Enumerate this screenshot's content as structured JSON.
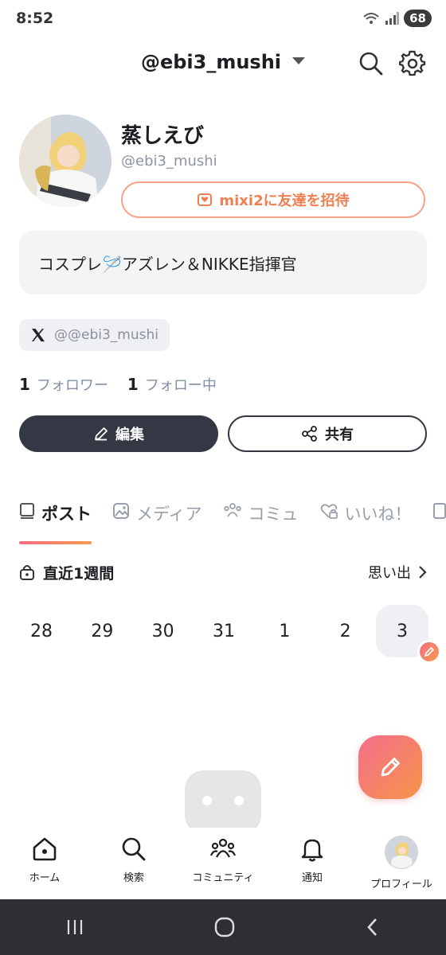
{
  "status_bar": {
    "time": "8:52",
    "battery": "68"
  },
  "header": {
    "username": "@ebi3_mushi"
  },
  "profile": {
    "display_name": "蒸しえび",
    "handle": "@ebi3_mushi",
    "invite_label": "mixi2に友達を招待",
    "bio": "コスプレ🪡アズレン＆NIKKE指揮官",
    "x_link": "@@ebi3_mushi",
    "followers_count": "1",
    "followers_label": "フォロワー",
    "following_count": "1",
    "following_label": "フォロー中",
    "edit_label": "編集",
    "share_label": "共有"
  },
  "tabs": [
    {
      "label": "ポスト",
      "icon": "post-icon",
      "active": true
    },
    {
      "label": "メディア",
      "icon": "image-icon"
    },
    {
      "label": "コミュ",
      "icon": "community-icon"
    },
    {
      "label": "いいね！",
      "icon": "heart-lock-icon"
    }
  ],
  "week": {
    "title": "直近1週間",
    "memories_label": "思い出",
    "dates": [
      "28",
      "29",
      "30",
      "31",
      "1",
      "2",
      "3"
    ]
  },
  "bottom_nav": [
    {
      "label": "ホーム",
      "icon": "home-icon"
    },
    {
      "label": "検索",
      "icon": "search-icon"
    },
    {
      "label": "コミュニティ",
      "icon": "community-icon"
    },
    {
      "label": "通知",
      "icon": "bell-icon"
    },
    {
      "label": "プロフィール",
      "icon": "avatar"
    }
  ],
  "colors": {
    "accent_start": "#f46e82",
    "accent_end": "#f69a4f",
    "dark_button": "#333844"
  }
}
